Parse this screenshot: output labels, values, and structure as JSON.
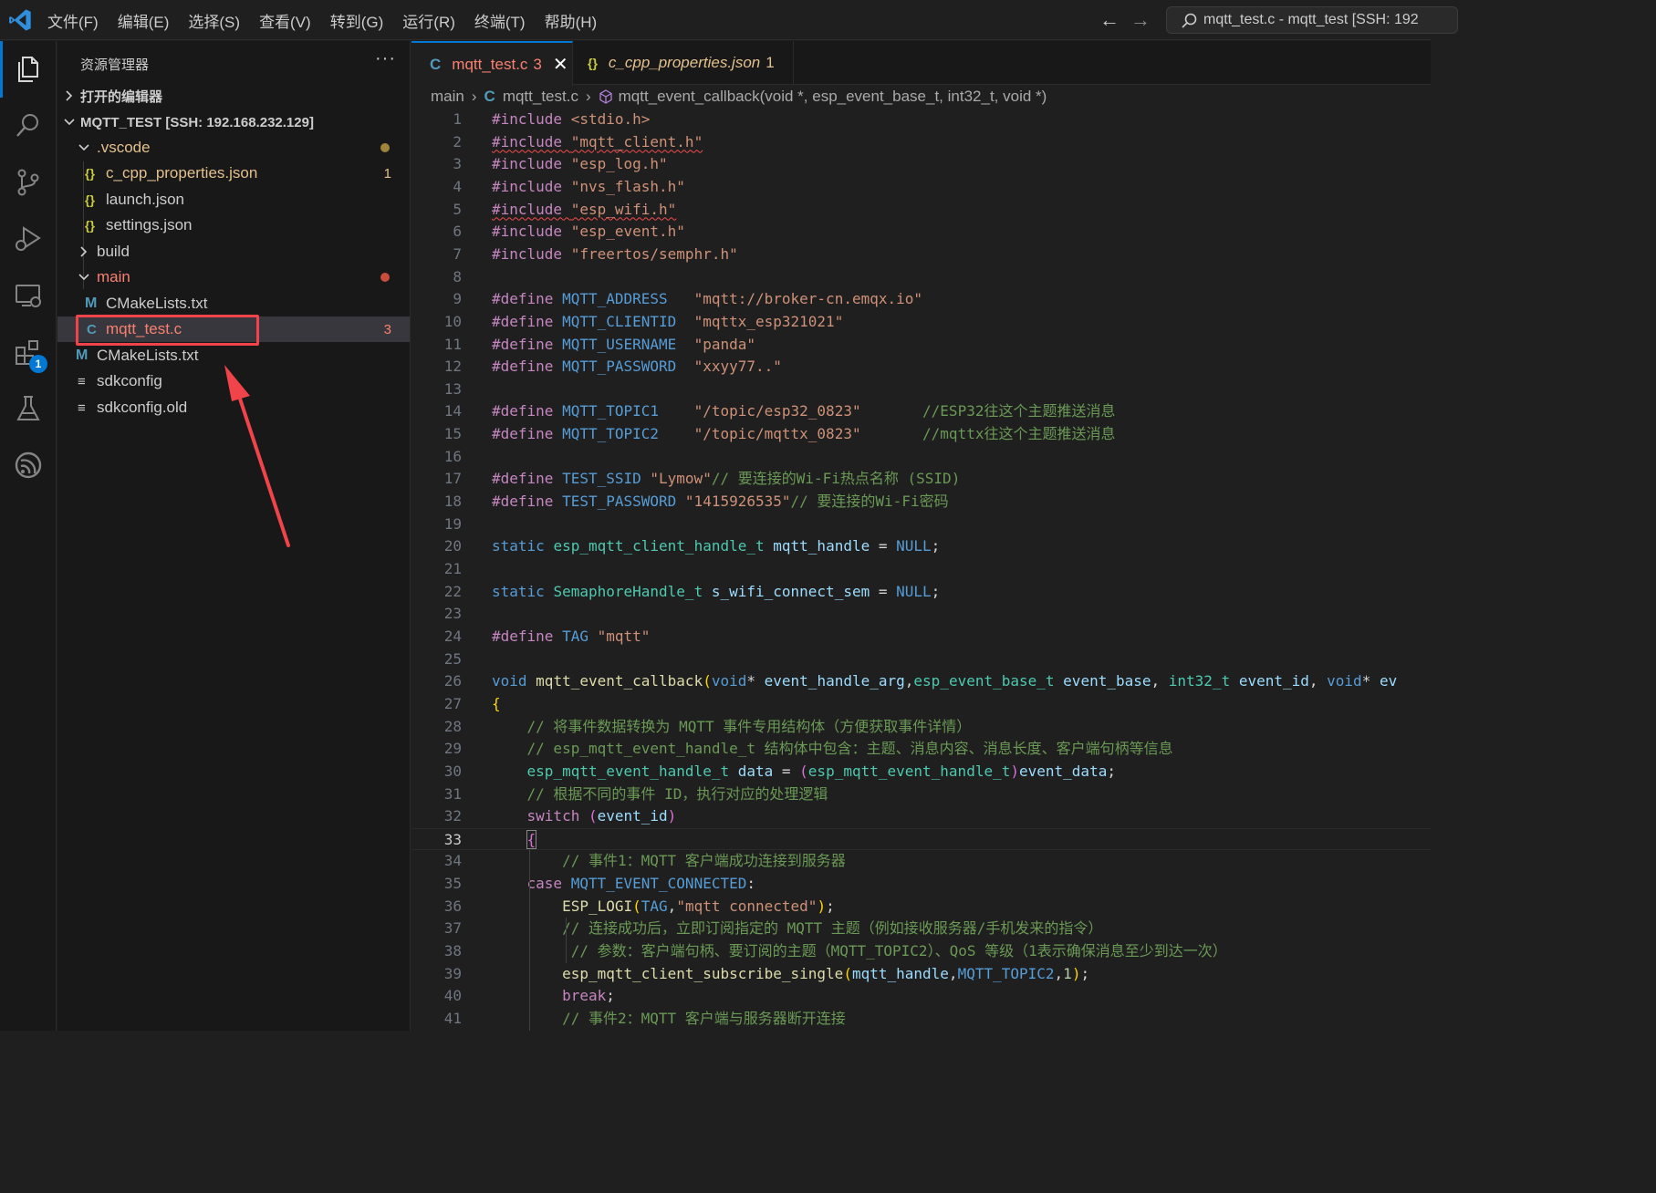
{
  "menu": [
    "文件(F)",
    "编辑(E)",
    "选择(S)",
    "查看(V)",
    "转到(G)",
    "运行(R)",
    "终端(T)",
    "帮助(H)"
  ],
  "command_center": "mqtt_test.c - mqtt_test [SSH: 192",
  "activity_badge": "1",
  "sidebar": {
    "title": "资源管理器",
    "more": "···",
    "open_editors": "打开的编辑器",
    "workspace": "MQTT_TEST [SSH: 192.168.232.129]",
    "vscode_folder": ".vscode",
    "files": {
      "c_cpp_properties": "c_cpp_properties.json",
      "c_cpp_properties_count": "1",
      "launch": "launch.json",
      "settings": "settings.json",
      "build": "build",
      "main": "main",
      "main_cmake": "CMakeLists.txt",
      "mqtt_test": "mqtt_test.c",
      "mqtt_test_count": "3",
      "root_cmake": "CMakeLists.txt",
      "sdkconfig": "sdkconfig",
      "sdkconfig_old": "sdkconfig.old"
    },
    "icons": {
      "json": "{}",
      "cmake": "M",
      "c": "C",
      "text": "≡"
    },
    "colors": {
      "modified": "#e2c08d",
      "error": "#f88070",
      "dot_modified": "#a0843a",
      "dot_error": "#c74e39"
    }
  },
  "tabs": [
    {
      "icon": "C",
      "label": "mqtt_test.c",
      "count": "3",
      "close": "✕"
    },
    {
      "icon": "{}",
      "label": "c_cpp_properties.json",
      "count": "1"
    }
  ],
  "breadcrumb": {
    "folder": "main",
    "file_icon": "C",
    "file": "mqtt_test.c",
    "symbol": "mqtt_event_callback(void *, esp_event_base_t, int32_t, void *)"
  },
  "editor": {
    "current_line": 33,
    "lines": [
      [
        [
          "t-pp",
          "#include "
        ],
        [
          "t-str",
          "<stdio.h>"
        ]
      ],
      [
        [
          "t-pp squig",
          "#include "
        ],
        [
          "t-str squig",
          "\"mqtt_client.h\""
        ]
      ],
      [
        [
          "t-pp",
          "#include "
        ],
        [
          "t-str",
          "\"esp_log.h\""
        ]
      ],
      [
        [
          "t-pp",
          "#include "
        ],
        [
          "t-str",
          "\"nvs_flash.h\""
        ]
      ],
      [
        [
          "t-pp squig",
          "#include "
        ],
        [
          "t-str squig",
          "\"esp_wifi.h\""
        ]
      ],
      [
        [
          "t-pp",
          "#include "
        ],
        [
          "t-str",
          "\"esp_event.h\""
        ]
      ],
      [
        [
          "t-pp",
          "#include "
        ],
        [
          "t-str",
          "\"freertos/semphr.h\""
        ]
      ],
      [],
      [
        [
          "t-pp",
          "#define "
        ],
        [
          "t-def",
          "MQTT_ADDRESS   "
        ],
        [
          "t-str",
          "\"mqtt://broker-cn.emqx.io\""
        ]
      ],
      [
        [
          "t-pp",
          "#define "
        ],
        [
          "t-def",
          "MQTT_CLIENTID  "
        ],
        [
          "t-str",
          "\"mqttx_esp321021\""
        ]
      ],
      [
        [
          "t-pp",
          "#define "
        ],
        [
          "t-def",
          "MQTT_USERNAME  "
        ],
        [
          "t-str",
          "\"panda\""
        ]
      ],
      [
        [
          "t-pp",
          "#define "
        ],
        [
          "t-def",
          "MQTT_PASSWORD  "
        ],
        [
          "t-str",
          "\"xxyy77..\""
        ]
      ],
      [],
      [
        [
          "t-pp",
          "#define "
        ],
        [
          "t-def",
          "MQTT_TOPIC1    "
        ],
        [
          "t-str",
          "\"/topic/esp32_0823\""
        ],
        [
          "t-plain",
          "       "
        ],
        [
          "t-cmt",
          "//ESP32往这个主题推送消息"
        ]
      ],
      [
        [
          "t-pp",
          "#define "
        ],
        [
          "t-def",
          "MQTT_TOPIC2    "
        ],
        [
          "t-str",
          "\"/topic/mqttx_0823\""
        ],
        [
          "t-plain",
          "       "
        ],
        [
          "t-cmt",
          "//mqttx往这个主题推送消息"
        ]
      ],
      [],
      [
        [
          "t-pp",
          "#define "
        ],
        [
          "t-def",
          "TEST_SSID "
        ],
        [
          "t-str",
          "\"Lymow\""
        ],
        [
          "t-cmt",
          "// 要连接的Wi-Fi热点名称 (SSID)"
        ]
      ],
      [
        [
          "t-pp",
          "#define "
        ],
        [
          "t-def",
          "TEST_PASSWORD "
        ],
        [
          "t-str",
          "\"1415926535\""
        ],
        [
          "t-cmt",
          "// 要连接的Wi-Fi密码"
        ]
      ],
      [],
      [
        [
          "t-kw",
          "static "
        ],
        [
          "t-type",
          "esp_mqtt_client_handle_t "
        ],
        [
          "t-var",
          "mqtt_handle "
        ],
        [
          "t-plain",
          "= "
        ],
        [
          "t-kw",
          "NULL"
        ],
        [
          "t-plain",
          ";"
        ]
      ],
      [],
      [
        [
          "t-kw",
          "static "
        ],
        [
          "t-type",
          "SemaphoreHandle_t "
        ],
        [
          "t-var",
          "s_wifi_connect_sem "
        ],
        [
          "t-plain",
          "= "
        ],
        [
          "t-kw",
          "NULL"
        ],
        [
          "t-plain",
          ";"
        ]
      ],
      [],
      [
        [
          "t-pp",
          "#define "
        ],
        [
          "t-def",
          "TAG "
        ],
        [
          "t-str",
          "\"mqtt\""
        ]
      ],
      [],
      [
        [
          "t-kw",
          "void "
        ],
        [
          "t-fn",
          "mqtt_event_callback"
        ],
        [
          "t-brace",
          "("
        ],
        [
          "t-kw",
          "void"
        ],
        [
          "t-plain",
          "* "
        ],
        [
          "t-var",
          "event_handle_arg"
        ],
        [
          "t-plain",
          ","
        ],
        [
          "t-type",
          "esp_event_base_t "
        ],
        [
          "t-var",
          "event_base"
        ],
        [
          "t-plain",
          ", "
        ],
        [
          "t-type",
          "int32_t "
        ],
        [
          "t-var",
          "event_id"
        ],
        [
          "t-plain",
          ", "
        ],
        [
          "t-kw",
          "void"
        ],
        [
          "t-plain",
          "* "
        ],
        [
          "t-var",
          "ev"
        ]
      ],
      [
        [
          "t-brace",
          "{"
        ]
      ],
      [
        [
          "t-plain",
          "    "
        ],
        [
          "t-cmt",
          "// 将事件数据转换为 MQTT 事件专用结构体（方便获取事件详情）"
        ]
      ],
      [
        [
          "t-plain",
          "    "
        ],
        [
          "t-cmt",
          "// esp_mqtt_event_handle_t 结构体中包含：主题、消息内容、消息长度、客户端句柄等信息"
        ]
      ],
      [
        [
          "t-plain",
          "    "
        ],
        [
          "t-type",
          "esp_mqtt_event_handle_t "
        ],
        [
          "t-var",
          "data "
        ],
        [
          "t-plain",
          "= "
        ],
        [
          "t-paren",
          "("
        ],
        [
          "t-type",
          "esp_mqtt_event_handle_t"
        ],
        [
          "t-paren",
          ")"
        ],
        [
          "t-var",
          "event_data"
        ],
        [
          "t-plain",
          ";"
        ]
      ],
      [
        [
          "t-plain",
          "    "
        ],
        [
          "t-cmt",
          "// 根据不同的事件 ID，执行对应的处理逻辑"
        ]
      ],
      [
        [
          "t-plain",
          "    "
        ],
        [
          "t-ctl",
          "switch "
        ],
        [
          "t-paren",
          "("
        ],
        [
          "t-var",
          "event_id"
        ],
        [
          "t-paren",
          ")"
        ]
      ],
      [
        [
          "t-plain",
          "    "
        ],
        [
          "t-paren cursor-box",
          "{"
        ]
      ],
      [
        [
          "t-plain",
          "        "
        ],
        [
          "t-cmt",
          "// 事件1：MQTT 客户端成功连接到服务器"
        ]
      ],
      [
        [
          "t-plain",
          "    "
        ],
        [
          "t-ctl",
          "case "
        ],
        [
          "t-def",
          "MQTT_EVENT_CONNECTED"
        ],
        [
          "t-plain",
          ":"
        ]
      ],
      [
        [
          "t-plain",
          "        "
        ],
        [
          "t-fn",
          "ESP_LOGI"
        ],
        [
          "t-brace",
          "("
        ],
        [
          "t-def",
          "TAG"
        ],
        [
          "t-plain",
          ","
        ],
        [
          "t-str",
          "\"mqtt connected\""
        ],
        [
          "t-brace",
          ")"
        ],
        [
          "t-plain",
          ";"
        ]
      ],
      [
        [
          "t-plain",
          "        "
        ],
        [
          "t-cmt",
          "// 连接成功后，立即订阅指定的 MQTT 主题（例如接收服务器/手机发来的指令）"
        ]
      ],
      [
        [
          "t-plain",
          "         "
        ],
        [
          "t-cmt",
          "// 参数：客户端句柄、要订阅的主题（MQTT_TOPIC2）、QoS 等级（1表示确保消息至少到达一次）"
        ]
      ],
      [
        [
          "t-plain",
          "        "
        ],
        [
          "t-fn",
          "esp_mqtt_client_subscribe_single"
        ],
        [
          "t-brace",
          "("
        ],
        [
          "t-var",
          "mqtt_handle"
        ],
        [
          "t-plain",
          ","
        ],
        [
          "t-def",
          "MQTT_TOPIC2"
        ],
        [
          "t-plain",
          ","
        ],
        [
          "t-num",
          "1"
        ],
        [
          "t-brace",
          ")"
        ],
        [
          "t-plain",
          ";"
        ]
      ],
      [
        [
          "t-plain",
          "        "
        ],
        [
          "t-ctl",
          "break"
        ],
        [
          "t-plain",
          ";"
        ]
      ],
      [
        [
          "t-plain",
          "        "
        ],
        [
          "t-cmt",
          "// 事件2：MQTT 客户端与服务器断开连接"
        ]
      ]
    ]
  }
}
